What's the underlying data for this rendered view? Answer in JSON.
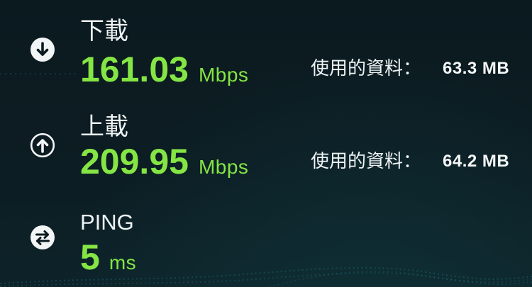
{
  "colors": {
    "background": "#0b1a1f",
    "accent": "#84e544",
    "text": "#eef3f4",
    "wave": "#2fb3c4"
  },
  "metrics": [
    {
      "label": "下載",
      "value": "161.03",
      "unit": "Mbps",
      "data_label": "使用的資料：",
      "data_value": "63.3 MB",
      "icon": "download-arrow-icon"
    },
    {
      "label": "上載",
      "value": "209.95",
      "unit": "Mbps",
      "data_label": "使用的資料：",
      "data_value": "64.2 MB",
      "icon": "upload-arrow-icon"
    },
    {
      "label": "PING",
      "value": "5",
      "unit": "ms",
      "icon": "ping-swap-arrows-icon"
    }
  ]
}
